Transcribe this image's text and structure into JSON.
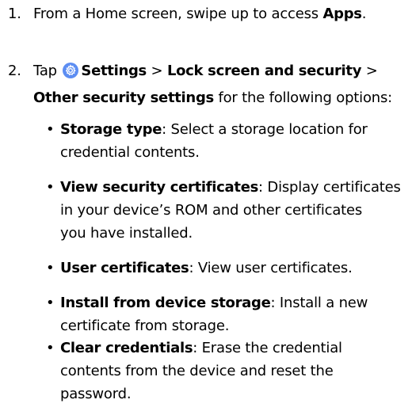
{
  "steps": [
    {
      "number": "1.",
      "text_before": "From a Home screen, swipe up to access ",
      "bold": "Apps",
      "text_after": "."
    },
    {
      "number": "2.",
      "tap_label": "Tap",
      "settings_label": "Settings",
      "separator": ">",
      "lock_label": "Lock screen and security",
      "other_label": "Other security settings",
      "tail": " for the following options:"
    }
  ],
  "icons": {
    "settings": "settings-gear-icon",
    "settings_color": "#5c8df2"
  },
  "options": [
    {
      "term": "Storage type",
      "lines": [
        ": Select a storage location for",
        "credential contents."
      ]
    },
    {
      "term": "View security certificates",
      "lines": [
        ": Display certificates",
        "in your device’s ROM and other certificates",
        "you have installed."
      ]
    },
    {
      "term": "User certificates",
      "lines": [
        ": View user certificates."
      ]
    },
    {
      "term": "Install from device storage",
      "lines": [
        ": Install a new",
        "certificate from storage."
      ]
    },
    {
      "term": "Clear credentials",
      "lines": [
        ": Erase the credential",
        "contents from the device and reset the",
        "password."
      ]
    }
  ],
  "bullet_glyph": "•"
}
